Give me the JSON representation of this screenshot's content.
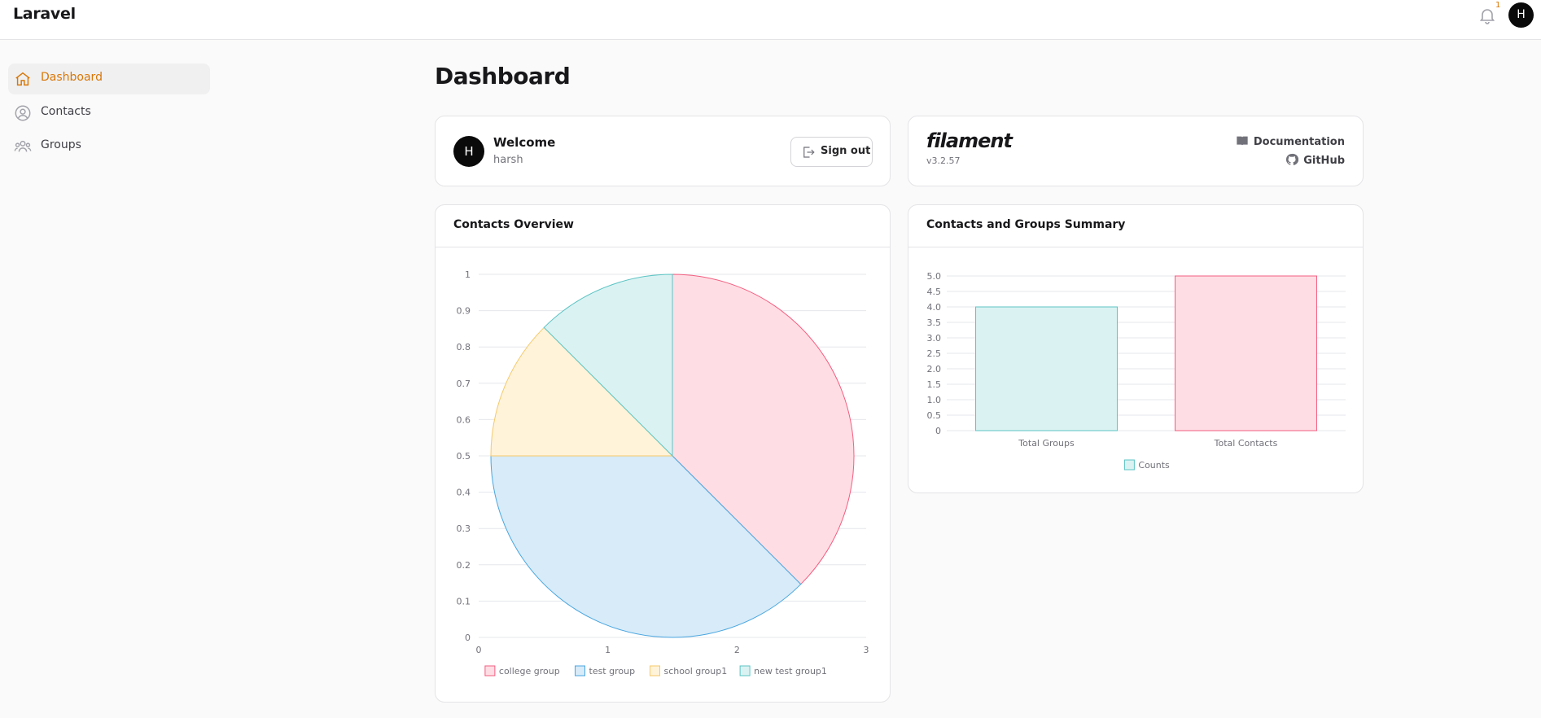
{
  "topbar": {
    "brand": "Laravel",
    "notification_count": "1",
    "avatar_initial": "H"
  },
  "sidebar": {
    "items": [
      {
        "label": "Dashboard",
        "icon": "home-icon",
        "active": true
      },
      {
        "label": "Contacts",
        "icon": "user-circle-icon",
        "active": false
      },
      {
        "label": "Groups",
        "icon": "user-group-icon",
        "active": false
      }
    ]
  },
  "page": {
    "title": "Dashboard"
  },
  "welcome": {
    "title": "Welcome",
    "username": "harsh",
    "avatar_initial": "H",
    "signout_label": "Sign out"
  },
  "filament": {
    "logo": "filament",
    "version": "v3.2.57",
    "documentation_label": "Documentation",
    "github_label": "GitHub"
  },
  "colors": {
    "accent": "#d97706",
    "pink_fill": "#ffdde4",
    "pink_stroke": "#f25e80",
    "blue_fill": "#d7ebf8",
    "blue_stroke": "#4aa6e0",
    "yellow_fill": "#fff3da",
    "yellow_stroke": "#f5c96a",
    "teal_fill": "#dbf2f2",
    "teal_stroke": "#5cc4c4"
  },
  "pie_card": {
    "title": "Contacts Overview"
  },
  "bar_card": {
    "title": "Contacts and Groups Summary"
  },
  "chart_data": [
    {
      "type": "pie",
      "title": "Contacts Overview",
      "categories": [
        "college group",
        "test group",
        "school group1",
        "new test group1"
      ],
      "values": [
        3,
        3,
        1,
        1
      ],
      "x_axis": {
        "ticks": [
          "0",
          "1",
          "2",
          "3"
        ],
        "range": [
          0,
          3
        ]
      },
      "y_axis": {
        "ticks": [
          "0",
          "0.1",
          "0.2",
          "0.3",
          "0.4",
          "0.5",
          "0.6",
          "0.7",
          "0.8",
          "0.9",
          "1"
        ],
        "range": [
          0,
          1
        ]
      },
      "grid": true,
      "legend": "bottom"
    },
    {
      "type": "bar",
      "title": "Contacts and Groups Summary",
      "categories": [
        "Total Groups",
        "Total Contacts"
      ],
      "series": [
        {
          "name": "Counts",
          "values": [
            4,
            5
          ]
        }
      ],
      "y_axis": {
        "ticks": [
          "0",
          "0.5",
          "1.0",
          "1.5",
          "2.0",
          "2.5",
          "3.0",
          "3.5",
          "4.0",
          "4.5",
          "5.0"
        ],
        "range": [
          0,
          5
        ]
      },
      "grid": true,
      "legend": "bottom"
    }
  ]
}
